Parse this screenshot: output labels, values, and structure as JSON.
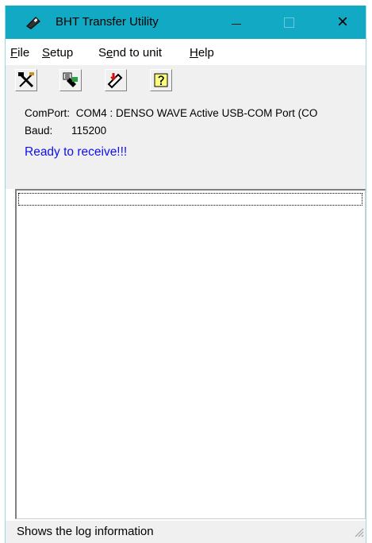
{
  "window": {
    "title": "BHT Transfer Utility",
    "accent_color": "#12a9c4"
  },
  "title_controls": {
    "minimize": "minimize-icon",
    "maximize": "maximize-icon",
    "close": "×"
  },
  "menu": {
    "file": {
      "u": "F",
      "rest": "ile"
    },
    "setup": {
      "u": "S",
      "rest": "etup"
    },
    "send_to_unit": {
      "pre": "S",
      "u": "e",
      "rest": "nd to unit"
    },
    "help": {
      "u": "H",
      "rest": "elp"
    }
  },
  "toolbar": {
    "buttons": [
      "setup-tools-icon",
      "receive-file-icon",
      "send-to-unit-icon",
      "help-icon"
    ]
  },
  "info": {
    "comport_label": "ComPort:",
    "comport_value": "COM4 : DENSO WAVE Active USB-COM Port (CO",
    "baud_label": "Baud:",
    "baud_value": "115200",
    "status": "Ready to receive!!!",
    "status_color": "#1010ee"
  },
  "statusbar": {
    "text": "Shows the log information"
  }
}
